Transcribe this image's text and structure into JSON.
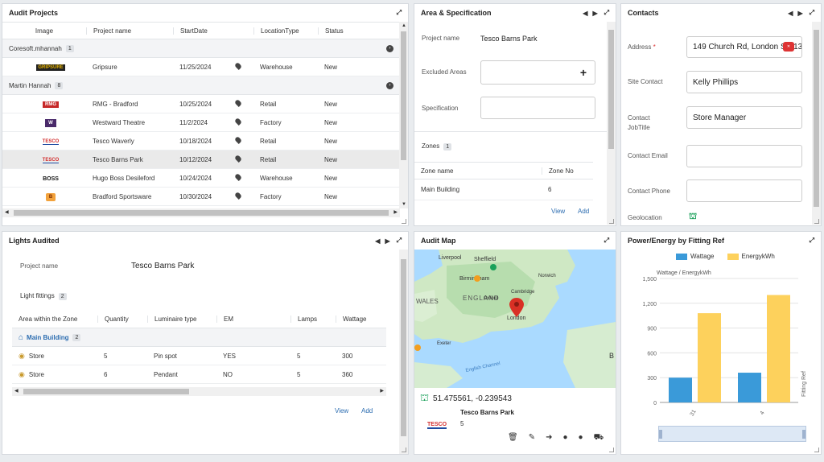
{
  "audit_projects": {
    "title": "Audit Projects",
    "columns": [
      "Image",
      "Project name",
      "StartDate",
      "LocationType",
      "Status"
    ],
    "groups": [
      {
        "name": "Coresoft.mhannah",
        "count": "1",
        "rows": [
          {
            "logo": "GRIPSURE",
            "name": "Gripsure",
            "date": "11/25/2024",
            "type": "Warehouse",
            "status": "New"
          }
        ]
      },
      {
        "name": "Martin Hannah",
        "count": "8",
        "rows": [
          {
            "logo": "RMG",
            "name": "RMG - Bradford",
            "date": "10/25/2024",
            "type": "Retail",
            "status": "New"
          },
          {
            "logo": "W",
            "name": "Westward Theatre",
            "date": "11/2/2024",
            "type": "Factory",
            "status": "New"
          },
          {
            "logo": "TESCO",
            "name": "Tesco Waverly",
            "date": "10/18/2024",
            "type": "Retail",
            "status": "New"
          },
          {
            "logo": "TESCO",
            "name": "Tesco Barns Park",
            "date": "10/12/2024",
            "type": "Retail",
            "status": "New"
          },
          {
            "logo": "BOSS",
            "name": "Hugo Boss Desileford",
            "date": "10/24/2024",
            "type": "Warehouse",
            "status": "New"
          },
          {
            "logo": "B",
            "name": "Bradford Sportsware",
            "date": "10/30/2024",
            "type": "Factory",
            "status": "New"
          }
        ]
      }
    ]
  },
  "area_spec": {
    "title": "Area & Specification",
    "project_label": "Project name",
    "project_value": "Tesco Barns Park",
    "excluded_label": "Excluded Areas",
    "spec_label": "Specification",
    "zones_label": "Zones",
    "zones_count": "1",
    "zone_cols": [
      "Zone name",
      "Zone No"
    ],
    "zones": [
      {
        "name": "Main Building",
        "no": "6"
      }
    ],
    "view": "View",
    "add": "Add"
  },
  "contacts": {
    "title": "Contacts",
    "address_label": "Address",
    "address_value": "149 Church Rd, London SW13",
    "site_contact_label": "Site Contact",
    "site_contact_value": "Kelly Phillips",
    "job_label": "Contact JobTitle",
    "job_value": "Store Manager",
    "email_label": "Contact Email",
    "phone_label": "Contact Phone",
    "geo_label": "Geolocation"
  },
  "lights": {
    "title": "Lights Audited",
    "project_label": "Project name",
    "project_value": "Tesco Barns Park",
    "fittings_label": "Light fittings",
    "fittings_count": "2",
    "columns": [
      "Area within the Zone",
      "Quantity",
      "Luminaire type",
      "EM",
      "Lamps",
      "Wattage"
    ],
    "group_name": "Main Building",
    "group_count": "2",
    "rows": [
      {
        "area": "Store",
        "qty": "5",
        "lum": "Pin spot",
        "em": "YES",
        "lamps": "5",
        "watt": "300"
      },
      {
        "area": "Store",
        "qty": "6",
        "lum": "Pendant",
        "em": "NO",
        "lamps": "5",
        "watt": "360"
      }
    ],
    "view": "View",
    "add": "Add"
  },
  "audit_map": {
    "title": "Audit Map",
    "coords": "51.475561, -0.239543",
    "place_name": "Tesco Barns Park",
    "place_num": "5",
    "logo": "TESCO",
    "labels": {
      "liverpool": "Liverpool",
      "sheffield": "Sheffield",
      "birmingham": "Birmingham",
      "norwich": "Norwich",
      "cambridge": "Cambridge",
      "england": "ENGLAND",
      "oxford": "Oxford",
      "london": "London",
      "wales": "WALES",
      "exeter": "Exeter",
      "channel": "English Channel",
      "b": "B"
    }
  },
  "chart_data": {
    "type": "bar",
    "title": "Power/Energy by Fitting Ref",
    "ylabel": "Wattage / EnergykWh",
    "right_label": "Fitting Ref",
    "categories": [
      "31",
      "4"
    ],
    "series": [
      {
        "name": "Wattage",
        "color": "#3a9ad9",
        "values": [
          300,
          360
        ]
      },
      {
        "name": "EnergykWh",
        "color": "#fdd15c",
        "values": [
          1080,
          1300
        ]
      }
    ],
    "yticks": [
      "0",
      "300",
      "600",
      "900",
      "1,200",
      "1,500"
    ],
    "ylim": [
      0,
      1500
    ],
    "legend": "top"
  }
}
